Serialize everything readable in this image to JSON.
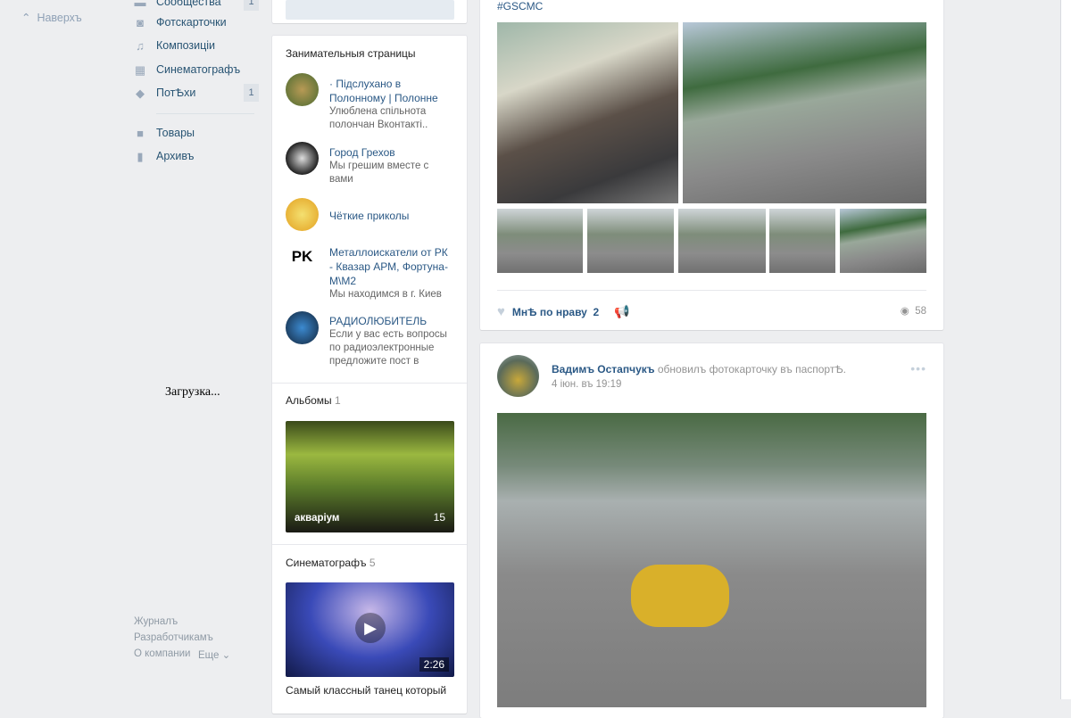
{
  "left": {
    "up_label": "Наверхъ",
    "loading": "Загрузка...",
    "footer": {
      "journal": "Журналъ",
      "dev": "Разработчикамъ",
      "about": "О компании",
      "more": "Еще"
    }
  },
  "nav": [
    {
      "label": "Сообщества",
      "icon": "groups-icon",
      "badge": "1"
    },
    {
      "label": "Фотскарточки",
      "icon": "camera-icon"
    },
    {
      "label": "Композиціи",
      "icon": "music-icon"
    },
    {
      "label": "Синематографъ",
      "icon": "film-icon"
    },
    {
      "label": "ПотѢхи",
      "icon": "gamepad-icon",
      "badge": "1"
    },
    {
      "label": "Товары",
      "icon": "bag-icon"
    },
    {
      "label": "Архивъ",
      "icon": "document-icon"
    }
  ],
  "pages": {
    "title": "Занимательныя страницы",
    "items": [
      {
        "name": "· Підслухано в Полонному | Полонне",
        "desc": "Улюблена спільнота полончан Вконтакті.."
      },
      {
        "name": "Город Грехов",
        "desc": "Мы грешим вместе с вами"
      },
      {
        "name": "Чёткие приколы",
        "desc": ""
      },
      {
        "name": "Металлоискатели от РК - Квазар АРМ, Фортуна-М\\М2",
        "desc": "Мы находимся в г. Киев"
      },
      {
        "name": "РАДИОЛЮБИТЕЛЬ",
        "desc": "Если у вас есть вопросы по радиоэлектронные предложите пост в"
      }
    ]
  },
  "albums": {
    "title": "Альбомы",
    "count": "1",
    "album_name": "акваріум",
    "album_count": "15"
  },
  "videos": {
    "title": "Синематографъ",
    "count": "5",
    "duration": "2:26",
    "caption": "Самый классный танец который"
  },
  "post1": {
    "hashtag": "#GSCMC",
    "like_label": "МнѢ по нраву",
    "likes": "2",
    "views": "58"
  },
  "post2": {
    "author": "Вадимъ Остапчукъ",
    "action": "обновилъ фотокарточку въ паспортѢ.",
    "date": "4 іюн. въ 19:19"
  }
}
